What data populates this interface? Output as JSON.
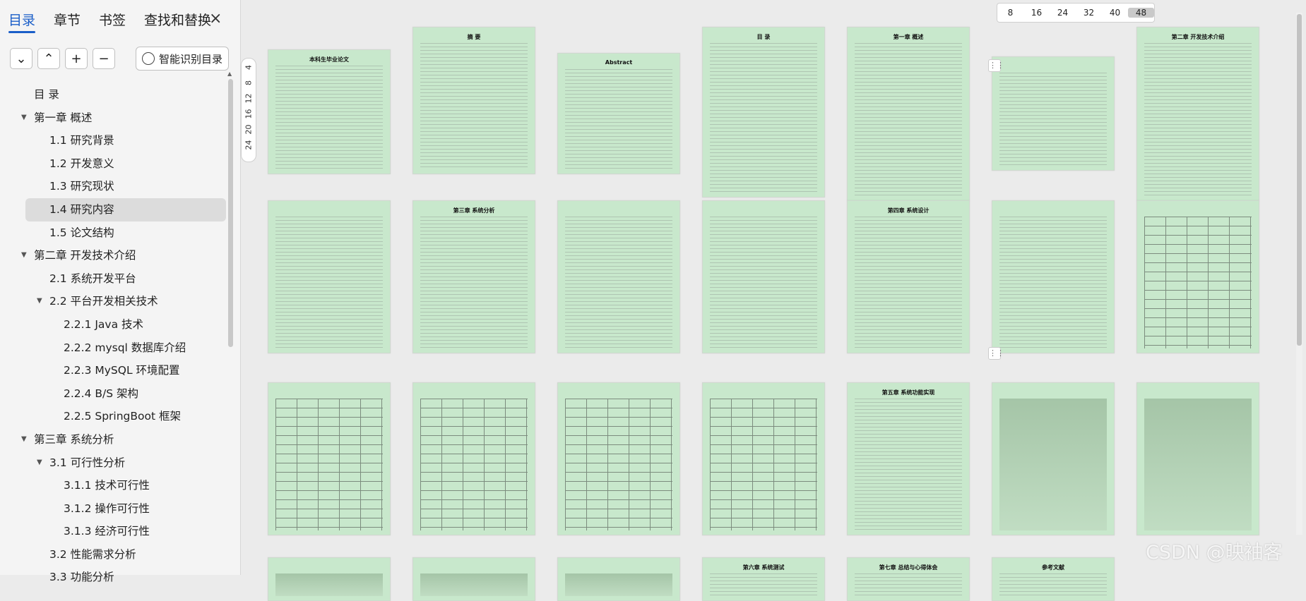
{
  "sidebar": {
    "tabs": [
      "目录",
      "章节",
      "书签",
      "查找和替换"
    ],
    "active_tab": "目录",
    "close_label": "×",
    "tool_buttons": [
      "⌄",
      "⌃",
      "+",
      "−"
    ],
    "smart_button_label": "智能识别目录",
    "toc": [
      {
        "label": "目 录",
        "level": 0
      },
      {
        "label": "第一章 概述",
        "level": 0,
        "expanded": true
      },
      {
        "label": "1.1 研究背景",
        "level": 1
      },
      {
        "label": "1.2 开发意义",
        "level": 1
      },
      {
        "label": "1.3 研究现状",
        "level": 1
      },
      {
        "label": "1.4 研究内容",
        "level": 1,
        "selected": true
      },
      {
        "label": "1.5 论文结构",
        "level": 1
      },
      {
        "label": "第二章 开发技术介绍",
        "level": 0,
        "expanded": true
      },
      {
        "label": "2.1 系统开发平台",
        "level": 1
      },
      {
        "label": "2.2 平台开发相关技术",
        "level": 1,
        "expanded": true
      },
      {
        "label": "2.2.1 Java 技术",
        "level": 2
      },
      {
        "label": "2.2.2 mysql 数据库介绍",
        "level": 2
      },
      {
        "label": "2.2.3 MySQL 环境配置",
        "level": 2
      },
      {
        "label": "2.2.4 B/S 架构",
        "level": 2
      },
      {
        "label": "2.2.5 SpringBoot 框架",
        "level": 2
      },
      {
        "label": "第三章 系统分析",
        "level": 0,
        "expanded": true
      },
      {
        "label": "3.1 可行性分析",
        "level": 1,
        "expanded": true
      },
      {
        "label": "3.1.1 技术可行性",
        "level": 2
      },
      {
        "label": "3.1.2 操作可行性",
        "level": 2
      },
      {
        "label": "3.1.3 经济可行性",
        "level": 2
      },
      {
        "label": "3.2 性能需求分析",
        "level": 1
      },
      {
        "label": "3.3 功能分析",
        "level": 1
      }
    ]
  },
  "zoom_side": [
    "4",
    "8",
    "12",
    "16",
    "20",
    "24"
  ],
  "zoom_top": {
    "values": [
      "8",
      "16",
      "24",
      "32",
      "40",
      "48"
    ],
    "current": "48"
  },
  "pages": [
    {
      "title": "本科生毕业论文",
      "kind": "text"
    },
    {
      "title": "摘 要",
      "kind": "text"
    },
    {
      "title": "Abstract",
      "kind": "text"
    },
    {
      "title": "目 录",
      "kind": "text"
    },
    {
      "title": "第一章 概述",
      "kind": "text"
    },
    {
      "title": "",
      "kind": "text"
    },
    {
      "title": "第二章 开发技术介绍",
      "kind": "text"
    },
    {
      "title": "",
      "kind": "text"
    },
    {
      "title": "第三章 系统分析",
      "kind": "text"
    },
    {
      "title": "",
      "kind": "text"
    },
    {
      "title": "",
      "kind": "text"
    },
    {
      "title": "第四章 系统设计",
      "kind": "text"
    },
    {
      "title": "",
      "kind": "diagram"
    },
    {
      "title": "",
      "kind": "table"
    },
    {
      "title": "",
      "kind": "table"
    },
    {
      "title": "",
      "kind": "table"
    },
    {
      "title": "",
      "kind": "table"
    },
    {
      "title": "",
      "kind": "table"
    },
    {
      "title": "第五章 系统功能实现",
      "kind": "text"
    },
    {
      "title": "",
      "kind": "shot"
    },
    {
      "title": "",
      "kind": "shot"
    },
    {
      "title": "",
      "kind": "shot"
    },
    {
      "title": "",
      "kind": "shot"
    },
    {
      "title": "",
      "kind": "shot"
    },
    {
      "title": "第六章 系统测试",
      "kind": "text"
    },
    {
      "title": "第七章 总结与心得体会",
      "kind": "text"
    },
    {
      "title": "参考文献",
      "kind": "text"
    }
  ],
  "watermark": "CSDN @映袖客",
  "colors": {
    "page_bg": "#c8e8cc",
    "accent": "#1a5ec8",
    "canvas_bg": "#ebebeb"
  }
}
